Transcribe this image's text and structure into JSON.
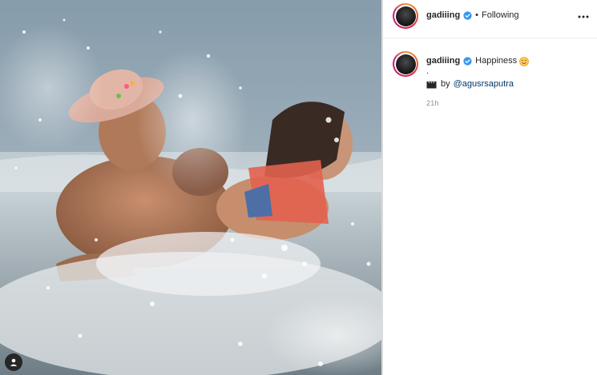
{
  "post": {
    "author": "gadiiing",
    "verified": true,
    "follow_state": "Following",
    "separator": "•",
    "caption": {
      "text": "Happiness",
      "emoji": "smiling-face-with-smiling-eyes",
      "dot_line": ".",
      "credit_prefix": "by",
      "credit_mention": "@agusrsaputra",
      "credit_icon": "clapper-board-icon"
    },
    "timestamp": "21h"
  },
  "media": {
    "description_icon": "user-tag-icon"
  },
  "colors": {
    "verified_badge": "#3897f0",
    "mention": "#00376b",
    "muted": "#8e8e8e",
    "text": "#262626"
  }
}
